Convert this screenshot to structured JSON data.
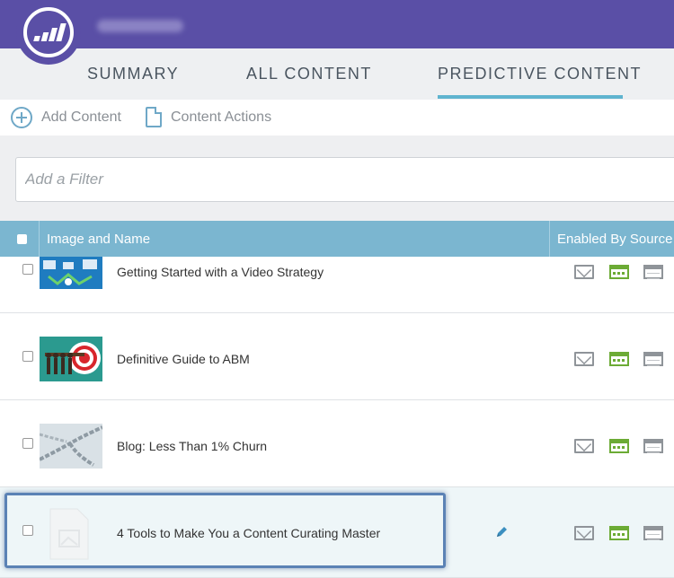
{
  "header": {
    "logo_icon": "marketo-logo-icon"
  },
  "tabs": [
    {
      "label": "SUMMARY",
      "active": false
    },
    {
      "label": "ALL CONTENT",
      "active": false
    },
    {
      "label": "PREDICTIVE CONTENT",
      "active": true
    }
  ],
  "toolbar": {
    "add_content_label": "Add Content",
    "content_actions_label": "Content Actions"
  },
  "filter": {
    "placeholder": "Add a Filter",
    "value": ""
  },
  "table": {
    "columns": [
      "Image and Name",
      "Enabled By Source"
    ],
    "rows": [
      {
        "name": "Getting Started with a Video Strategy",
        "sources": [
          "email-icon",
          "web-page-icon",
          "content-page-icon"
        ]
      },
      {
        "name": "Definitive Guide to ABM",
        "sources": [
          "email-icon",
          "web-page-icon",
          "content-page-icon"
        ]
      },
      {
        "name": "Blog: Less Than 1% Churn",
        "sources": [
          "email-icon",
          "web-page-icon",
          "content-page-icon"
        ]
      },
      {
        "name": "4 Tools to Make You a Content Curating Master",
        "sources": [
          "email-icon",
          "web-page-icon",
          "content-page-icon"
        ],
        "highlighted": true,
        "editable": true
      }
    ]
  },
  "colors": {
    "header_bg": "#5a4fa6",
    "table_header_bg": "#7bb6d0",
    "accent_underline": "#5fb4cf",
    "web_icon_green": "#6cab35",
    "highlight_border": "#5b82b5"
  }
}
